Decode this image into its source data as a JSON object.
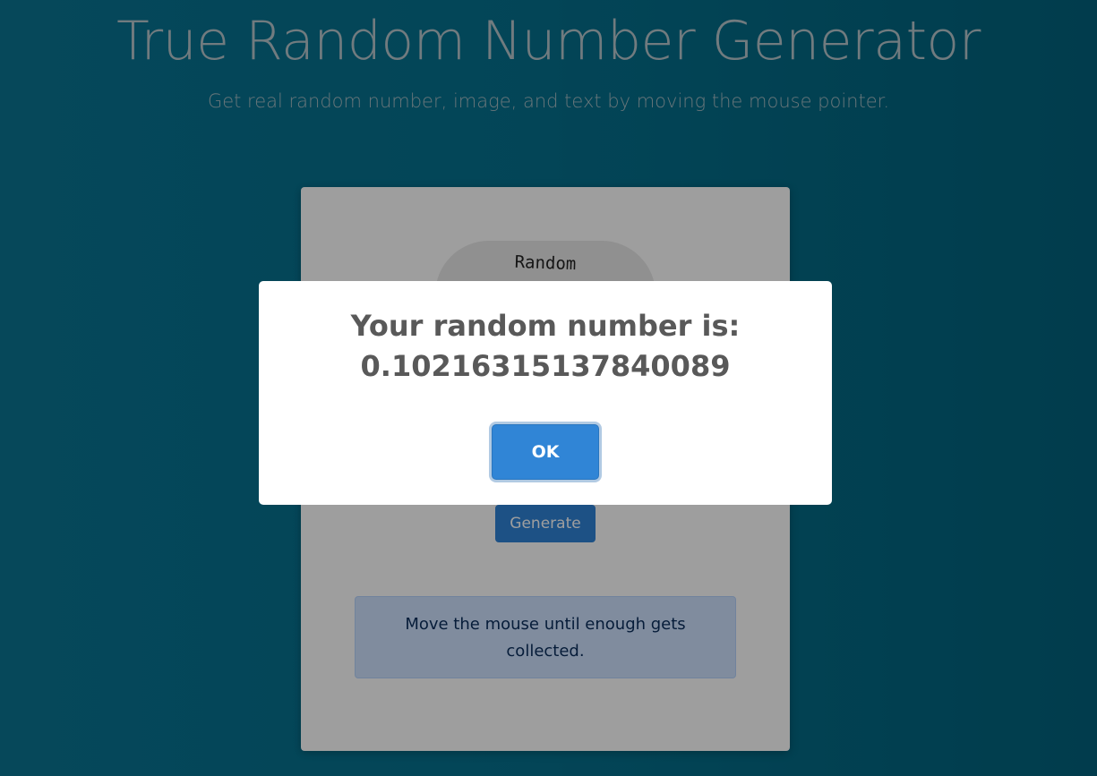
{
  "header": {
    "title": "True Random Number Generator",
    "subtitle": "Get real random number, image, and text by moving the mouse pointer."
  },
  "card": {
    "logo_text": "Random",
    "generate_label": "Generate",
    "info_text": "Move the mouse until enough gets collected."
  },
  "modal": {
    "title": "Your random number is:",
    "value": "0.10216315137840089",
    "ok_label": "OK"
  },
  "colors": {
    "background": "#05708d",
    "accent": "#3085d6",
    "modal_text": "#595959"
  }
}
